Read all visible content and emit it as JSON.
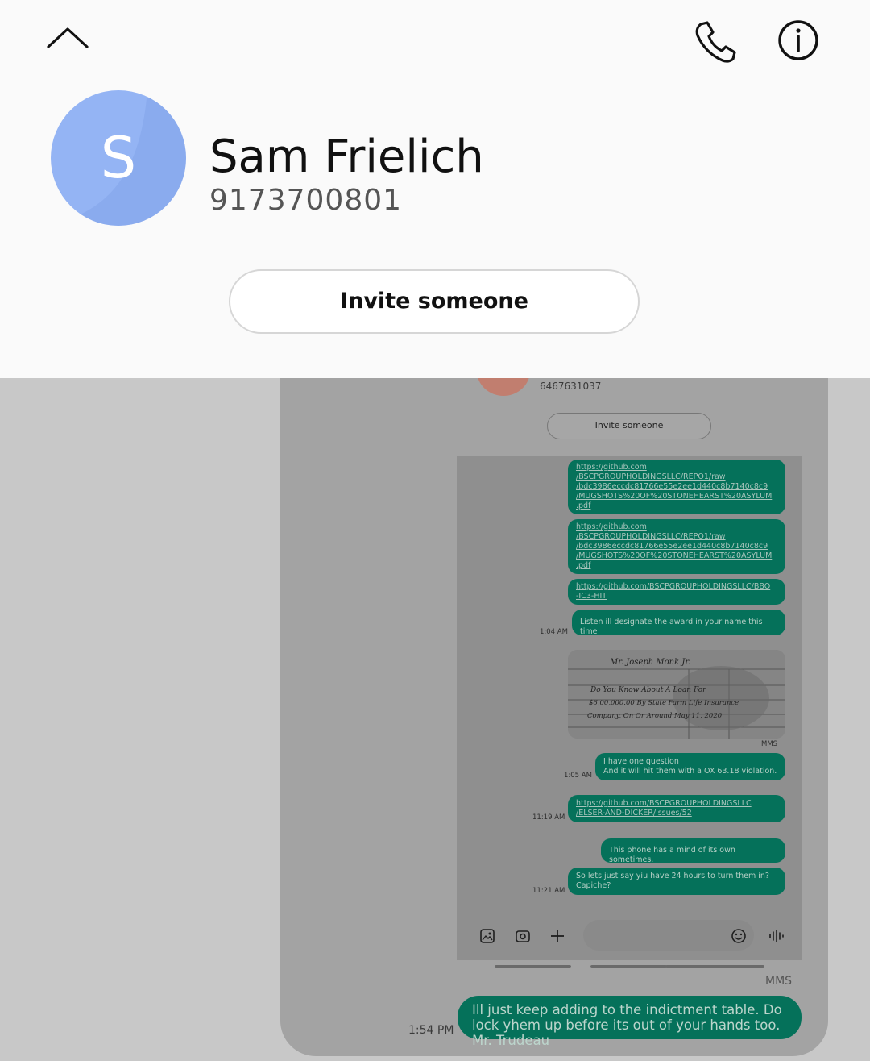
{
  "contact": {
    "initial": "S",
    "name": "Sam Frielich",
    "number": "9173700801",
    "invite_label": "Invite someone"
  },
  "icons": {
    "collapse": "chevron-up-icon",
    "call": "phone-icon",
    "info": "info-icon"
  },
  "colors": {
    "avatar": "#94b4f4",
    "bubble": "#05715a",
    "header_bg": "#fafafa",
    "overlay_bg": "#c8c8c8"
  },
  "screenshot": {
    "contact_number": "6467631037",
    "invite_label": "Invite someone",
    "messages": [
      {
        "text": "https://github.com\n/BSCPGROUPHOLDINGSLLC/REPO1/raw\n/bdc3986eccdc81766e55e2ee1d440c8b7140c8c9\n/MUGSHOTS%20OF%20STONEHEARST%20ASYLUM\n.pdf",
        "link": true
      },
      {
        "text": "https://github.com\n/BSCPGROUPHOLDINGSLLC/REPO1/raw\n/bdc3986eccdc81766e55e2ee1d440c8b7140c8c9\n/MUGSHOTS%20OF%20STONEHEARST%20ASYLUM\n.pdf",
        "link": true
      },
      {
        "text": "https://github.com/BSCPGROUPHOLDINGSLLC/BBO\n-IC3-HIT",
        "link": true
      },
      {
        "text": "Listen ill designate the award in your name this time",
        "link": false,
        "time": "1:04 AM"
      },
      {
        "text": "I have one question\nAnd it will hit them with a OX 63.18 violation.",
        "link": false,
        "time": "1:05 AM"
      },
      {
        "text": "https://github.com/BSCPGROUPHOLDINGSLLC\n/ELSER-AND-DICKER/issues/52",
        "link": true,
        "time": "11:19 AM"
      },
      {
        "text": "This phone has a mind of its own sometimes.",
        "link": false
      },
      {
        "text": "So lets just say yiu have 24 hours to turn them in?\nCapiche?",
        "link": false,
        "time": "11:21 AM"
      }
    ],
    "image_note": {
      "header": "Mr. Joseph Monk Jr.",
      "line1": "Do You Know About A Loan For",
      "line2": "$6,00,000.00 By State Farm Life Insurance",
      "line3": "Company, On Or Around May 11, 2020",
      "tag": "MMS"
    }
  },
  "latest_message": {
    "type_label": "MMS",
    "time": "1:54 PM",
    "text": "Ill just keep adding to the indictment table. Do lock yhem up before its out of your hands too. Mr. Trudeau"
  }
}
